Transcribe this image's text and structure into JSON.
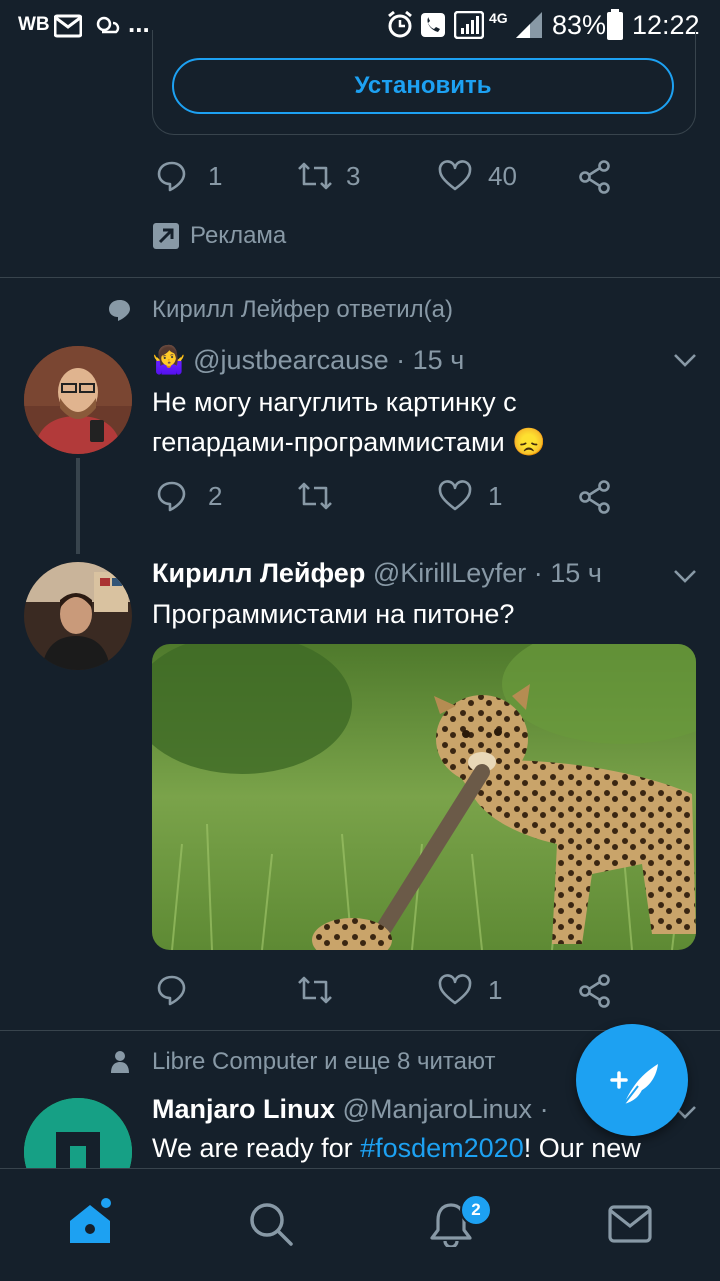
{
  "status_bar": {
    "carrier": "WB",
    "dots": "...",
    "signal_label": "4G",
    "battery": "83%",
    "time": "12:22"
  },
  "ad": {
    "install_label": "Установить",
    "replies": "1",
    "retweets": "3",
    "likes": "40",
    "promoted_label": "Реклама"
  },
  "reply_context": {
    "text": "Кирилл Лейфер ответил(а)"
  },
  "tweet1": {
    "emoji": "🤷‍♀️",
    "handle": "@justbearcause",
    "time": "· 15 ч",
    "text_line1": "Не могу нагуглить картинку с",
    "text_line2": "гепардами-программистами",
    "emoji_end": "😞",
    "replies": "2",
    "retweets": "",
    "likes": "1"
  },
  "tweet2": {
    "name": "Кирилл Лейфер",
    "handle": "@KirillLeyfer",
    "time": "· 15 ч",
    "text": "Программистами на питоне?",
    "replies": "",
    "retweets": "",
    "likes": "1"
  },
  "follow_context": {
    "text": "Libre Computer и еще 8 читают"
  },
  "tweet3": {
    "name": "Manjaro Linux",
    "handle": "@ManjaroLinux",
    "time": "·",
    "text_before": "We are ready for ",
    "hashtag": "#fosdem2020",
    "text_after": "! Our new"
  },
  "nav": {
    "notifications_badge": "2"
  },
  "colors": {
    "background": "#15202b",
    "accent": "#1da1f2",
    "muted": "#8899a6",
    "divider": "#38444d"
  },
  "icons": [
    "home-icon",
    "search-icon",
    "bell-icon",
    "mail-icon",
    "reply-icon",
    "retweet-icon",
    "heart-icon",
    "share-icon",
    "compose-icon",
    "chevron-down-icon"
  ]
}
